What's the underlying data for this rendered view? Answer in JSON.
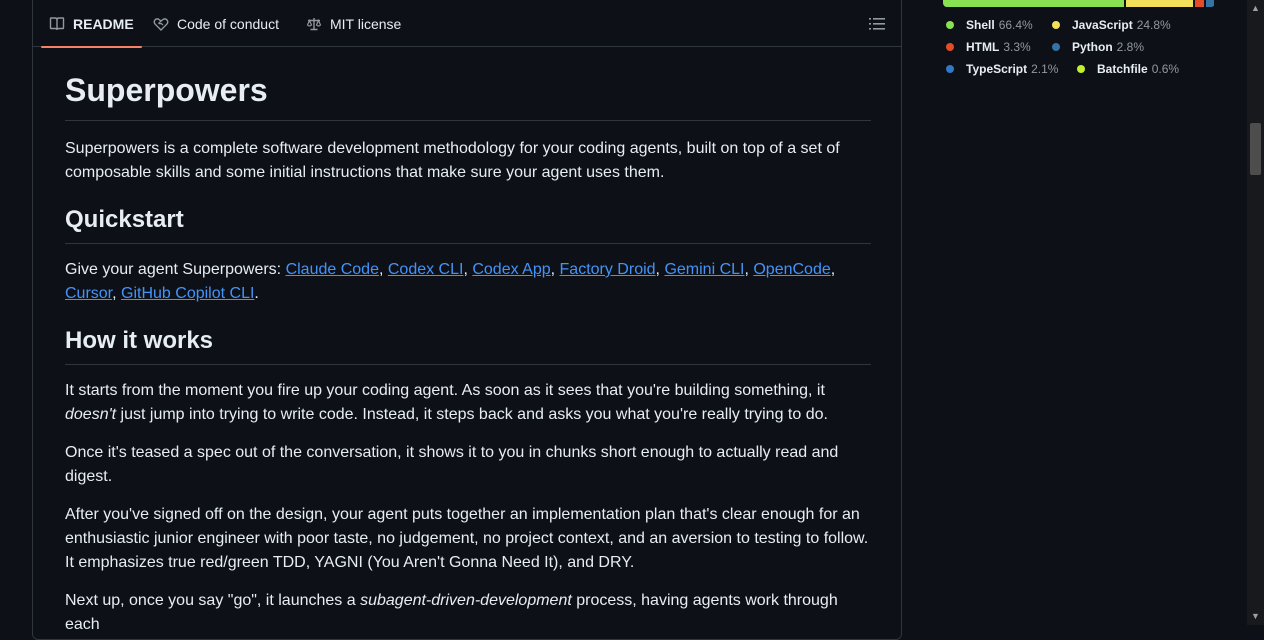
{
  "tabs": {
    "readme": "README",
    "conduct": "Code of conduct",
    "license": "MIT license"
  },
  "languages": {
    "items": [
      {
        "name": "Shell",
        "pct": "66.4%",
        "color": "#89e051"
      },
      {
        "name": "JavaScript",
        "pct": "24.8%",
        "color": "#f1e05a"
      },
      {
        "name": "HTML",
        "pct": "3.3%",
        "color": "#e34c26"
      },
      {
        "name": "Python",
        "pct": "2.8%",
        "color": "#3572A5"
      },
      {
        "name": "TypeScript",
        "pct": "2.1%",
        "color": "#3178c6"
      },
      {
        "name": "Batchfile",
        "pct": "0.6%",
        "color": "#C1F12E"
      }
    ]
  },
  "readme": {
    "title": "Superpowers",
    "intro": "Superpowers is a complete software development methodology for your coding agents, built on top of a set of composable skills and some initial instructions that make sure your agent uses them.",
    "quickstart_heading": "Quickstart",
    "quickstart_prefix": "Give your agent Superpowers: ",
    "links": [
      "Claude Code",
      "Codex CLI",
      "Codex App",
      "Factory Droid",
      "Gemini CLI",
      "OpenCode",
      "Cursor",
      "GitHub Copilot CLI"
    ],
    "sep": ", ",
    "end": ".",
    "how_heading": "How it works",
    "p1_a": "It starts from the moment you fire up your coding agent. As soon as it sees that you're building something, it ",
    "p1_em": "doesn't",
    "p1_b": " just jump into trying to write code. Instead, it steps back and asks you what you're really trying to do.",
    "p2": "Once it's teased a spec out of the conversation, it shows it to you in chunks short enough to actually read and digest.",
    "p3": "After you've signed off on the design, your agent puts together an implementation plan that's clear enough for an enthusiastic junior engineer with poor taste, no judgement, no project context, and an aversion to testing to follow. It emphasizes true red/green TDD, YAGNI (You Aren't Gonna Need It), and DRY.",
    "p4_a": "Next up, once you say \"go\", it launches a ",
    "p4_em": "subagent-driven-development",
    "p4_b": " process, having agents work through each"
  }
}
